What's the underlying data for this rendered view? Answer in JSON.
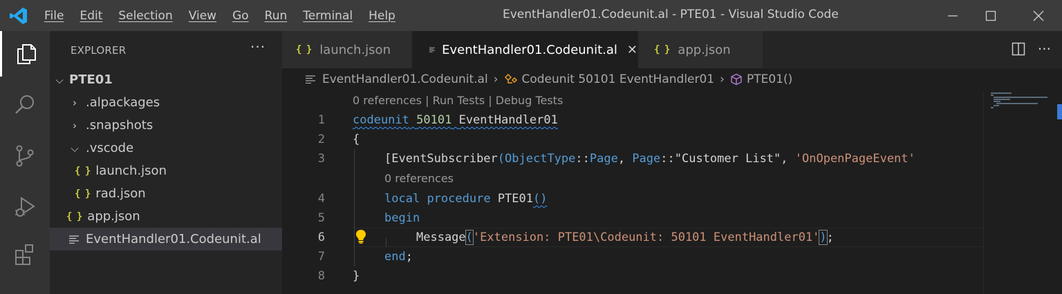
{
  "titlebar": {
    "menu": [
      "File",
      "Edit",
      "Selection",
      "View",
      "Go",
      "Run",
      "Terminal",
      "Help"
    ],
    "title": "EventHandler01.Codeunit.al - PTE01 - Visual Studio Code"
  },
  "activitybar": {
    "items": [
      "explorer-icon",
      "search-icon",
      "source-control-icon",
      "run-debug-icon",
      "extensions-icon"
    ],
    "active": "explorer-icon"
  },
  "sidebar": {
    "header": "EXPLORER",
    "more": "···",
    "tree": [
      {
        "label": "PTE01",
        "kind": "root",
        "expanded": true
      },
      {
        "label": ".alpackages",
        "kind": "folder",
        "expanded": false
      },
      {
        "label": ".snapshots",
        "kind": "folder",
        "expanded": false
      },
      {
        "label": ".vscode",
        "kind": "folder",
        "expanded": true
      },
      {
        "label": "launch.json",
        "kind": "json"
      },
      {
        "label": "rad.json",
        "kind": "json"
      },
      {
        "label": "app.json",
        "kind": "json"
      },
      {
        "label": "EventHandler01.Codeunit.al",
        "kind": "file",
        "selected": true
      }
    ],
    "json_icon": "{ }"
  },
  "tabs": [
    {
      "label": "launch.json",
      "icon": "json-icon"
    },
    {
      "label": "EventHandler01.Codeunit.al",
      "icon": "file-icon",
      "active": true,
      "close": "✕"
    },
    {
      "label": "app.json",
      "icon": "json-icon"
    }
  ],
  "breadcrumb": {
    "file": "EventHandler01.Codeunit.al",
    "object": "Codeunit 50101 EventHandler01",
    "method": "PTE01()"
  },
  "editor": {
    "codelens": {
      "top": "0 references | Run Tests | Debug Tests",
      "procedure": "0 references"
    },
    "line_numbers": [
      "1",
      "2",
      "3",
      "4",
      "5",
      "6",
      "7",
      "8"
    ],
    "current_line": "6",
    "lines": {
      "l1": {
        "kw": "codeunit",
        "num": "50101",
        "name": "EventHandler01"
      },
      "l2": {
        "text": "{"
      },
      "l3": {
        "open": "[",
        "attr": "EventSubscriber",
        "p1": "(",
        "t1": "ObjectType",
        "sep1": "::",
        "t2": "Page",
        "comma1": ", ",
        "t3": "Page",
        "sep2": "::",
        "q": "\"Customer List\"",
        "comma2": ", ",
        "s": "'OnOpenPageEvent'"
      },
      "l4": {
        "kw1": "local",
        "kw2": "procedure",
        "name": "PTE01",
        "parens": "()"
      },
      "l5": {
        "kw": "begin"
      },
      "l6": {
        "fn": "Message",
        "open": "(",
        "str": "'Extension: PTE01\\Codeunit: 50101 EventHandler01'",
        "close": ")",
        "end": ";"
      },
      "l7": {
        "kw": "end",
        "end": ";"
      },
      "l8": {
        "text": "}"
      }
    }
  },
  "colors": {
    "keyword": "#569cd6",
    "number": "#b5cea8",
    "type": "#4ec9b0",
    "string": "#ce9178",
    "function": "#dcdcaa",
    "json_icon": "#cbcb41",
    "titlebar_bg": "#3c3c3c"
  }
}
